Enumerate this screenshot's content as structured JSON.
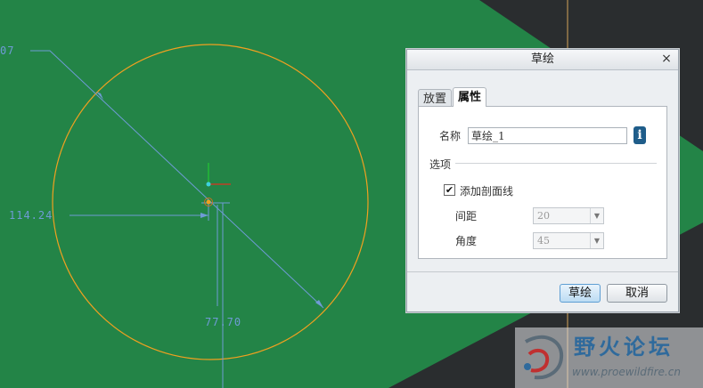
{
  "canvas": {
    "dim_top": "07",
    "dim_left": "114.24",
    "dim_bottom": "77.70"
  },
  "dialog": {
    "title": "草绘",
    "close_glyph": "×",
    "tabs": [
      {
        "label": "放置"
      },
      {
        "label": "属性"
      }
    ],
    "name_label": "名称",
    "name_value": "草绘_1",
    "info_glyph": "i",
    "options_label": "选项",
    "checkbox_label": "添加剖面线",
    "checkbox_checked": "✔",
    "spacing_label": "间距",
    "spacing_value": "20",
    "angle_label": "角度",
    "angle_value": "45",
    "dropdown_arrow": "▼",
    "ok_label": "草绘",
    "cancel_label": "取消"
  },
  "watermark": {
    "text": "野火论坛",
    "url": "www.proewildfire.cn"
  },
  "colors": {
    "sketch_plane": "#238447",
    "background": "#2a2d2f",
    "circle": "#f0a020",
    "dimension": "#6f9bd6"
  }
}
